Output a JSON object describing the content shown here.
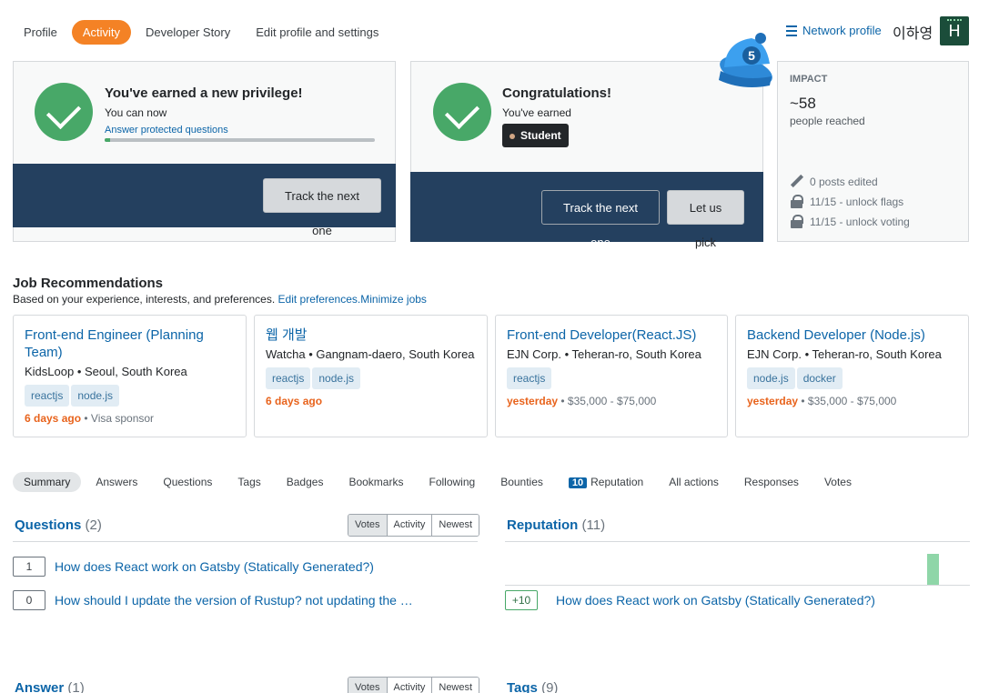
{
  "nav": {
    "tabs": [
      {
        "label": "Profile",
        "active": false
      },
      {
        "label": "Activity",
        "active": true
      },
      {
        "label": "Developer Story",
        "active": false
      },
      {
        "label": "Edit profile and settings",
        "active": false
      }
    ],
    "network_profile": "Network profile",
    "username": "이하영",
    "avatar_letter": "H"
  },
  "privilege_card": {
    "title": "You've earned a new privilege!",
    "subtitle": "You can now",
    "link": "Answer protected questions",
    "progress": 0.02,
    "button": "Track the next one"
  },
  "badge_card": {
    "title": "Congratulations!",
    "subtitle": "You've earned",
    "badge": "Student",
    "button_track": "Track the next one",
    "button_pick": "Let us pick",
    "hat_number": "5"
  },
  "impact": {
    "heading": "IMPACT",
    "value": "~58",
    "label": "people reached",
    "rows": [
      {
        "icon": "pencil-icon",
        "text": "0 posts edited"
      },
      {
        "icon": "lock-icon",
        "text": "11/15 - unlock flags"
      },
      {
        "icon": "lock-icon",
        "text": "11/15 - unlock voting"
      }
    ]
  },
  "jobs": {
    "heading": "Job Recommendations",
    "subtitle": "Based on your experience, interests, and preferences.",
    "edit_link": "Edit preferences.",
    "minimize_link": "Minimize jobs",
    "items": [
      {
        "title": "Front-end Engineer (Planning Team)",
        "company": "KidsLoop • Seoul, South Korea",
        "tags": [
          "reactjs",
          "node.js"
        ],
        "posted": "6 days ago",
        "extra": " • Visa sponsor"
      },
      {
        "title": "웹 개발",
        "company": "Watcha • Gangnam-daero, South Korea",
        "tags": [
          "reactjs",
          "node.js"
        ],
        "posted": "6 days ago",
        "extra": ""
      },
      {
        "title": "Front-end Developer(React.JS)",
        "company": "EJN Corp. • Teheran-ro, South Korea",
        "tags": [
          "reactjs"
        ],
        "posted": "yesterday",
        "extra": " • $35,000 - $75,000"
      },
      {
        "title": "Backend Developer (Node.js)",
        "company": "EJN Corp. • Teheran-ro, South Korea",
        "tags": [
          "node.js",
          "docker"
        ],
        "posted": "yesterday",
        "extra": " • $35,000 - $75,000"
      }
    ]
  },
  "subnav": {
    "tabs": [
      "Summary",
      "Answers",
      "Questions",
      "Tags",
      "Badges",
      "Bookmarks",
      "Following",
      "Bounties",
      "Reputation",
      "All actions",
      "Responses",
      "Votes"
    ],
    "reputation_count": "10"
  },
  "questions": {
    "title": "Questions",
    "count": "(2)",
    "sort": [
      "Votes",
      "Activity",
      "Newest"
    ],
    "items": [
      {
        "votes": "1",
        "title": "How does React work on Gatsby (Statically Generated?)"
      },
      {
        "votes": "0",
        "title": "How should I update the version of Rustup? not updating the …"
      }
    ]
  },
  "reputation": {
    "title": "Reputation",
    "count": "(11)",
    "items": [
      {
        "change": "+10",
        "title": "How does React work on Gatsby (Statically Generated?)"
      }
    ]
  },
  "answers": {
    "title": "Answer",
    "count": "(1)",
    "sort": [
      "Votes",
      "Activity",
      "Newest"
    ]
  },
  "tags": {
    "title": "Tags",
    "count": "(9)"
  },
  "colors": {
    "accent_orange": "#f48225",
    "link_blue": "#0c65a8",
    "band_navy": "#24405f",
    "success_green": "#48a868"
  }
}
